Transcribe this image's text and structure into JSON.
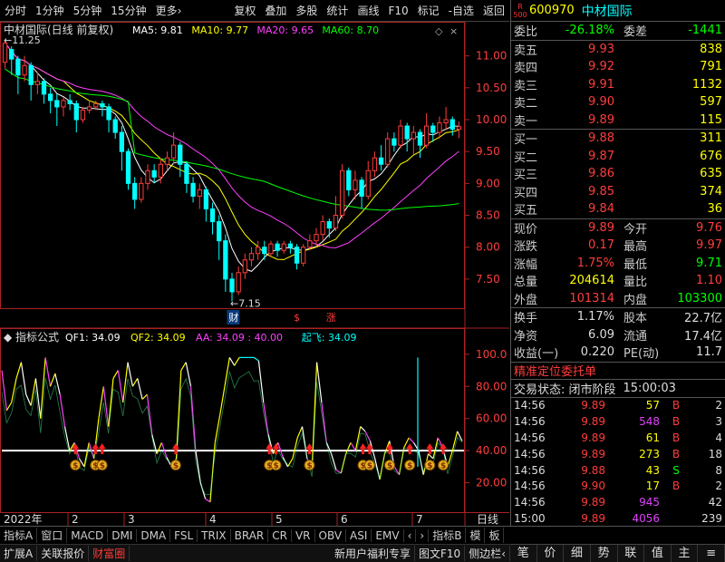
{
  "toolbar": {
    "left": [
      "分时",
      "1分钟",
      "5分钟",
      "15分钟",
      "更多›"
    ],
    "right": [
      "复权",
      "叠加",
      "多股",
      "统计",
      "画线",
      "F10",
      "标记",
      "-自选",
      "返回"
    ]
  },
  "kline": {
    "title": "中材国际(日线 前复权)",
    "ma": [
      {
        "label": "MA5: 9.81",
        "color": "#ffffff"
      },
      {
        "label": "MA10: 9.77",
        "color": "#ffff00"
      },
      {
        "label": "MA20: 9.65",
        "color": "#ff40ff"
      },
      {
        "label": "MA60: 8.70",
        "color": "#00ff00"
      }
    ],
    "ylabels": [
      "11.00",
      "10.50",
      "10.00",
      "9.50",
      "9.00",
      "8.50",
      "8.00",
      "7.50"
    ],
    "yticks": [
      11.0,
      10.5,
      10.0,
      9.5,
      9.0,
      8.5,
      8.0,
      7.5
    ],
    "ymin": 7.1,
    "ymax": 11.45,
    "high_label": "11.25",
    "low_label": "7.15",
    "marks": [
      {
        "t": "财",
        "idx": 35
      },
      {
        "t": "$",
        "idx": 45
      },
      {
        "t": "涨",
        "idx": 50
      }
    ],
    "candles": [
      [
        10.9,
        11.2,
        11.25,
        10.8
      ],
      [
        11.1,
        10.95,
        11.15,
        10.7
      ],
      [
        10.95,
        10.7,
        11.0,
        10.4
      ],
      [
        10.7,
        10.85,
        11.0,
        10.6
      ],
      [
        10.85,
        10.55,
        10.9,
        10.3
      ],
      [
        10.55,
        10.6,
        10.75,
        10.4
      ],
      [
        10.6,
        10.4,
        10.65,
        10.25
      ],
      [
        10.4,
        10.3,
        10.5,
        10.1
      ],
      [
        10.3,
        10.2,
        10.4,
        9.9
      ],
      [
        10.2,
        10.3,
        10.35,
        10.05
      ],
      [
        10.3,
        10.25,
        10.4,
        10.15
      ],
      [
        10.25,
        10.0,
        10.3,
        9.8
      ],
      [
        10.0,
        10.15,
        10.2,
        9.95
      ],
      [
        10.15,
        10.2,
        10.3,
        10.1
      ],
      [
        10.2,
        10.25,
        10.3,
        10.15
      ],
      [
        10.25,
        10.2,
        10.3,
        10.05
      ],
      [
        10.2,
        10.0,
        10.25,
        9.8
      ],
      [
        10.0,
        9.8,
        10.05,
        9.7
      ],
      [
        9.8,
        9.5,
        9.9,
        9.2
      ],
      [
        9.5,
        9.0,
        9.55,
        8.9
      ],
      [
        9.0,
        8.75,
        9.1,
        8.6
      ],
      [
        8.75,
        9.0,
        9.1,
        8.7
      ],
      [
        9.0,
        9.2,
        9.3,
        8.9
      ],
      [
        9.2,
        9.1,
        9.3,
        9.0
      ],
      [
        9.1,
        9.3,
        9.4,
        9.0
      ],
      [
        9.3,
        9.4,
        9.5,
        9.2
      ],
      [
        9.4,
        9.6,
        9.8,
        9.3
      ],
      [
        9.6,
        9.3,
        9.65,
        9.1
      ],
      [
        9.3,
        9.0,
        9.35,
        8.85
      ],
      [
        9.0,
        8.8,
        9.1,
        8.7
      ],
      [
        8.8,
        8.9,
        9.0,
        8.6
      ],
      [
        8.9,
        8.6,
        8.95,
        8.4
      ],
      [
        8.6,
        8.4,
        8.7,
        8.2
      ],
      [
        8.4,
        8.1,
        8.5,
        7.8
      ],
      [
        8.1,
        7.5,
        8.2,
        7.3
      ],
      [
        7.5,
        7.3,
        7.6,
        7.15
      ],
      [
        7.3,
        7.6,
        7.7,
        7.25
      ],
      [
        7.6,
        7.8,
        7.9,
        7.5
      ],
      [
        7.8,
        7.9,
        8.0,
        7.7
      ],
      [
        7.9,
        8.0,
        8.1,
        7.8
      ],
      [
        8.0,
        7.9,
        8.1,
        7.8
      ],
      [
        7.9,
        8.05,
        8.1,
        7.85
      ],
      [
        8.05,
        7.95,
        8.1,
        7.85
      ],
      [
        7.95,
        8.05,
        8.1,
        7.9
      ],
      [
        8.05,
        8.0,
        8.1,
        7.9
      ],
      [
        8.0,
        7.75,
        8.05,
        7.65
      ],
      [
        7.75,
        8.0,
        8.05,
        7.7
      ],
      [
        8.0,
        8.1,
        8.2,
        7.95
      ],
      [
        8.1,
        8.2,
        8.3,
        8.0
      ],
      [
        8.2,
        8.4,
        8.5,
        8.1
      ],
      [
        8.4,
        8.3,
        8.45,
        8.15
      ],
      [
        8.3,
        8.5,
        8.8,
        8.25
      ],
      [
        8.5,
        9.2,
        9.3,
        8.45
      ],
      [
        9.2,
        8.9,
        9.25,
        8.8
      ],
      [
        8.9,
        9.05,
        9.2,
        8.75
      ],
      [
        9.05,
        8.8,
        9.1,
        8.6
      ],
      [
        8.8,
        9.2,
        9.35,
        8.75
      ],
      [
        9.2,
        9.4,
        9.5,
        9.1
      ],
      [
        9.4,
        9.3,
        9.6,
        9.2
      ],
      [
        9.3,
        9.7,
        9.8,
        9.25
      ],
      [
        9.7,
        9.6,
        9.8,
        9.5
      ],
      [
        9.6,
        9.9,
        10.0,
        9.55
      ],
      [
        9.9,
        9.7,
        9.95,
        9.5
      ],
      [
        9.7,
        9.8,
        9.9,
        9.45
      ],
      [
        9.8,
        9.6,
        9.85,
        9.4
      ],
      [
        9.6,
        9.9,
        10.1,
        9.55
      ],
      [
        9.9,
        9.8,
        9.95,
        9.65
      ],
      [
        9.8,
        9.95,
        10.05,
        9.7
      ],
      [
        9.95,
        10.0,
        10.2,
        9.85
      ],
      [
        10.0,
        9.85,
        10.05,
        9.75
      ],
      [
        9.85,
        9.89,
        9.97,
        9.71
      ]
    ]
  },
  "indicator": {
    "title": "指标公式",
    "items": [
      {
        "label": "QF1: 34.09",
        "color": "#ffffff"
      },
      {
        "label": "QF2: 34.09",
        "color": "#ffff00"
      },
      {
        "label": "AA: 34.09 : 40.00",
        "color": "#ff40ff"
      },
      {
        "label": "起飞: 34.09",
        "color": "#00ffff"
      }
    ],
    "ylabels": [
      "100.0",
      "80.00",
      "60.00",
      "40.00",
      "20.00"
    ],
    "yticks": [
      100,
      80,
      60,
      40,
      20
    ],
    "values": [
      90,
      65,
      70,
      85,
      95,
      75,
      68,
      85,
      60,
      98,
      80,
      88,
      75,
      55,
      40,
      45,
      35,
      30,
      45,
      35,
      60,
      80,
      55,
      85,
      90,
      70,
      95,
      80,
      85,
      72,
      75,
      50,
      38,
      45,
      36,
      30,
      35,
      90,
      95,
      80,
      40,
      20,
      10,
      8,
      45,
      62,
      80,
      98,
      93,
      98,
      98,
      98,
      98,
      96,
      70,
      50,
      38,
      45,
      36,
      30,
      35,
      48,
      55,
      35,
      28,
      95,
      70,
      45,
      38,
      28,
      26,
      38,
      45,
      40,
      55,
      52,
      46,
      35,
      22,
      38,
      46,
      30,
      25,
      42,
      48,
      45,
      40,
      25,
      38,
      35,
      48,
      42,
      30,
      40,
      52,
      46
    ],
    "signals": [
      11,
      14,
      15,
      26,
      40,
      41,
      46,
      54,
      55,
      58,
      61,
      64,
      66,
      69,
      71
    ]
  },
  "dates": {
    "year": "2022年",
    "months": [
      {
        "m": "2",
        "x": 75
      },
      {
        "m": "3",
        "x": 137
      },
      {
        "m": "4",
        "x": 227
      },
      {
        "m": "5",
        "x": 300
      },
      {
        "m": "6",
        "x": 372
      },
      {
        "m": "7",
        "x": 455
      }
    ],
    "period": "日线"
  },
  "tabs1": [
    "指标A",
    "窗口",
    "MACD",
    "DMI",
    "DMA",
    "FSL",
    "TRIX",
    "BRAR",
    "CR",
    "VR",
    "OBV",
    "ASI",
    "EMV",
    "‹",
    "›",
    "指标B",
    "模",
    "板"
  ],
  "tabs2": [
    "扩展A",
    "关联报价",
    "财富圈"
  ],
  "tabs2_right": [
    "新用户福利专享",
    "图文F10",
    "侧边栏‹"
  ],
  "stock": {
    "badge_r": "R",
    "badge_n": "500",
    "code": "600970",
    "name": "中材国际"
  },
  "wb": {
    "label": "委比",
    "value": "-26.18%",
    "label2": "委差",
    "value2": "-1441"
  },
  "asks": [
    {
      "label": "卖五",
      "price": "9.93",
      "vol": "838"
    },
    {
      "label": "卖四",
      "price": "9.92",
      "vol": "791"
    },
    {
      "label": "卖三",
      "price": "9.91",
      "vol": "1132"
    },
    {
      "label": "卖二",
      "price": "9.90",
      "vol": "597"
    },
    {
      "label": "卖一",
      "price": "9.89",
      "vol": "115"
    }
  ],
  "bids": [
    {
      "label": "买一",
      "price": "9.88",
      "vol": "311"
    },
    {
      "label": "买二",
      "price": "9.87",
      "vol": "676"
    },
    {
      "label": "买三",
      "price": "9.86",
      "vol": "635"
    },
    {
      "label": "买四",
      "price": "9.85",
      "vol": "374"
    },
    {
      "label": "买五",
      "price": "9.84",
      "vol": "36"
    }
  ],
  "quote": [
    {
      "l1": "现价",
      "v1": "9.89",
      "c1": "red",
      "l2": "今开",
      "v2": "9.76",
      "c2": "red"
    },
    {
      "l1": "涨跌",
      "v1": "0.17",
      "c1": "red",
      "l2": "最高",
      "v2": "9.97",
      "c2": "red"
    },
    {
      "l1": "涨幅",
      "v1": "1.75%",
      "c1": "red",
      "l2": "最低",
      "v2": "9.71",
      "c2": "green"
    },
    {
      "l1": "总量",
      "v1": "204614",
      "c1": "yel",
      "l2": "量比",
      "v2": "1.10",
      "c2": "red"
    },
    {
      "l1": "外盘",
      "v1": "101314",
      "c1": "red",
      "l2": "内盘",
      "v2": "103300",
      "c2": "green"
    }
  ],
  "stats": [
    {
      "l1": "换手",
      "v1": "1.17%",
      "l2": "股本",
      "v2": "22.7亿"
    },
    {
      "l1": "净资",
      "v1": "6.09",
      "l2": "流通",
      "v2": "17.4亿"
    },
    {
      "l1": "收益(一)",
      "v1": "0.220",
      "l2": "PE(动)",
      "v2": "11.7"
    }
  ],
  "precise": "精准定位委托单",
  "trade_status": "交易状态: 闭市阶段",
  "trade_time": "15:00:03",
  "trades": [
    {
      "t": "14:56",
      "p": "9.89",
      "q": "57",
      "qc": "yel",
      "bs": "B",
      "bc": "red",
      "n": "2"
    },
    {
      "t": "14:56",
      "p": "9.89",
      "q": "548",
      "qc": "mag",
      "bs": "B",
      "bc": "red",
      "n": "3"
    },
    {
      "t": "14:56",
      "p": "9.89",
      "q": "61",
      "qc": "yel",
      "bs": "B",
      "bc": "red",
      "n": "4"
    },
    {
      "t": "14:56",
      "p": "9.89",
      "q": "273",
      "qc": "yel",
      "bs": "B",
      "bc": "red",
      "n": "18"
    },
    {
      "t": "14:56",
      "p": "9.88",
      "q": "43",
      "qc": "yel",
      "bs": "S",
      "bc": "green",
      "n": "8"
    },
    {
      "t": "14:56",
      "p": "9.90",
      "q": "17",
      "qc": "yel",
      "bs": "B",
      "bc": "red",
      "n": "2"
    },
    {
      "t": "14:56",
      "p": "9.89",
      "q": "945",
      "qc": "mag",
      "bs": "",
      "bc": "red",
      "n": "42"
    },
    {
      "t": "15:00",
      "p": "9.89",
      "q": "4056",
      "qc": "mag",
      "bs": "",
      "bc": "red",
      "n": "239"
    }
  ],
  "nav": [
    "笔",
    "价",
    "细",
    "势",
    "联",
    "值",
    "主",
    "≡"
  ]
}
